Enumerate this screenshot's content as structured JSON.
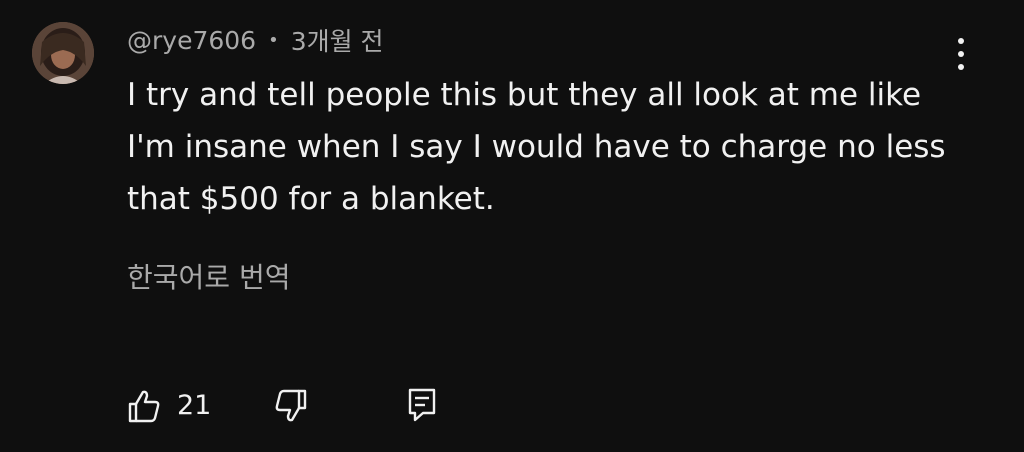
{
  "comment": {
    "author": "@rye7606",
    "separator": "•",
    "time_ago": "3개월 전",
    "text": "I try and tell people this but they all look at me like I'm insane when I say I would have to charge no less that $500 for a blanket.",
    "translate_label": "한국어로 번역",
    "like_count": "21"
  },
  "icons": {
    "avatar": "avatar",
    "more": "more-vert-icon",
    "like": "thumbs-up-icon",
    "dislike": "thumbs-down-icon",
    "reply": "reply-comment-icon"
  },
  "colors": {
    "background": "#0f0f0f",
    "primary_text": "#f1f1f1",
    "secondary_text": "#aaaaaa"
  }
}
